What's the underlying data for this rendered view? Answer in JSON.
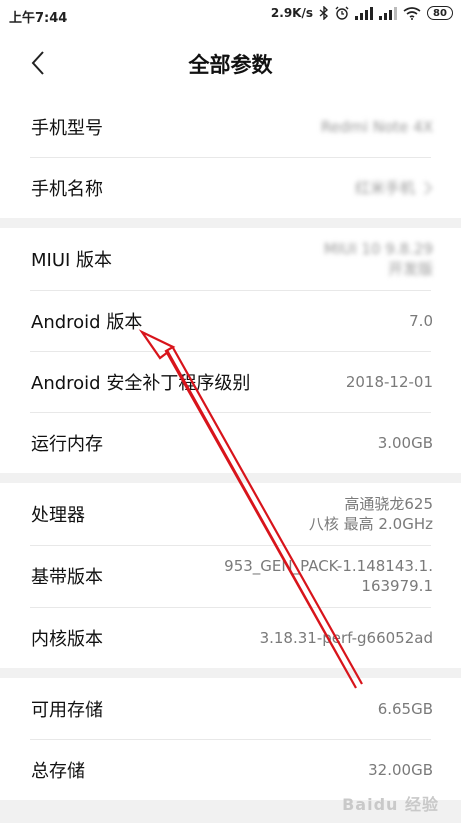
{
  "status_bar": {
    "time": "上午7:44",
    "net_speed": "2.9K/s",
    "battery": "80"
  },
  "header": {
    "title": "全部参数"
  },
  "groups": [
    {
      "rows": [
        {
          "label": "手机型号",
          "value": "Redmi Note 4X",
          "blurred": true,
          "chevron": false
        },
        {
          "label": "手机名称",
          "value": "红米手机",
          "blurred": true,
          "chevron": true
        }
      ]
    },
    {
      "rows": [
        {
          "label": "MIUI 版本",
          "value": "MIUI 10 9.8.29\n开发版",
          "blurred": true,
          "chevron": false
        },
        {
          "label": "Android 版本",
          "value": "7.0",
          "blurred": false,
          "chevron": false
        },
        {
          "label": "Android 安全补丁程序级别",
          "value": "2018-12-01",
          "blurred": false,
          "chevron": false
        },
        {
          "label": "运行内存",
          "value": "3.00GB",
          "blurred": false,
          "chevron": false
        }
      ]
    },
    {
      "rows": [
        {
          "label": "处理器",
          "value": "高通骁龙625\n八核 最高 2.0GHz",
          "blurred": false,
          "chevron": false
        },
        {
          "label": "基带版本",
          "value": "953_GEN_PACK-1.148143.1.\n163979.1",
          "blurred": false,
          "chevron": false
        },
        {
          "label": "内核版本",
          "value": "3.18.31-perf-g66052ad",
          "blurred": false,
          "chevron": false
        }
      ]
    },
    {
      "rows": [
        {
          "label": "可用存储",
          "value": "6.65GB",
          "blurred": false,
          "chevron": false
        },
        {
          "label": "总存储",
          "value": "32.00GB",
          "blurred": false,
          "chevron": false
        }
      ]
    }
  ],
  "watermark": "Baidu 经验",
  "colors": {
    "annotation_arrow": "#d8141b",
    "background": "#f1f1f1",
    "row_background": "#ffffff",
    "value_text": "#7a7a7a"
  }
}
